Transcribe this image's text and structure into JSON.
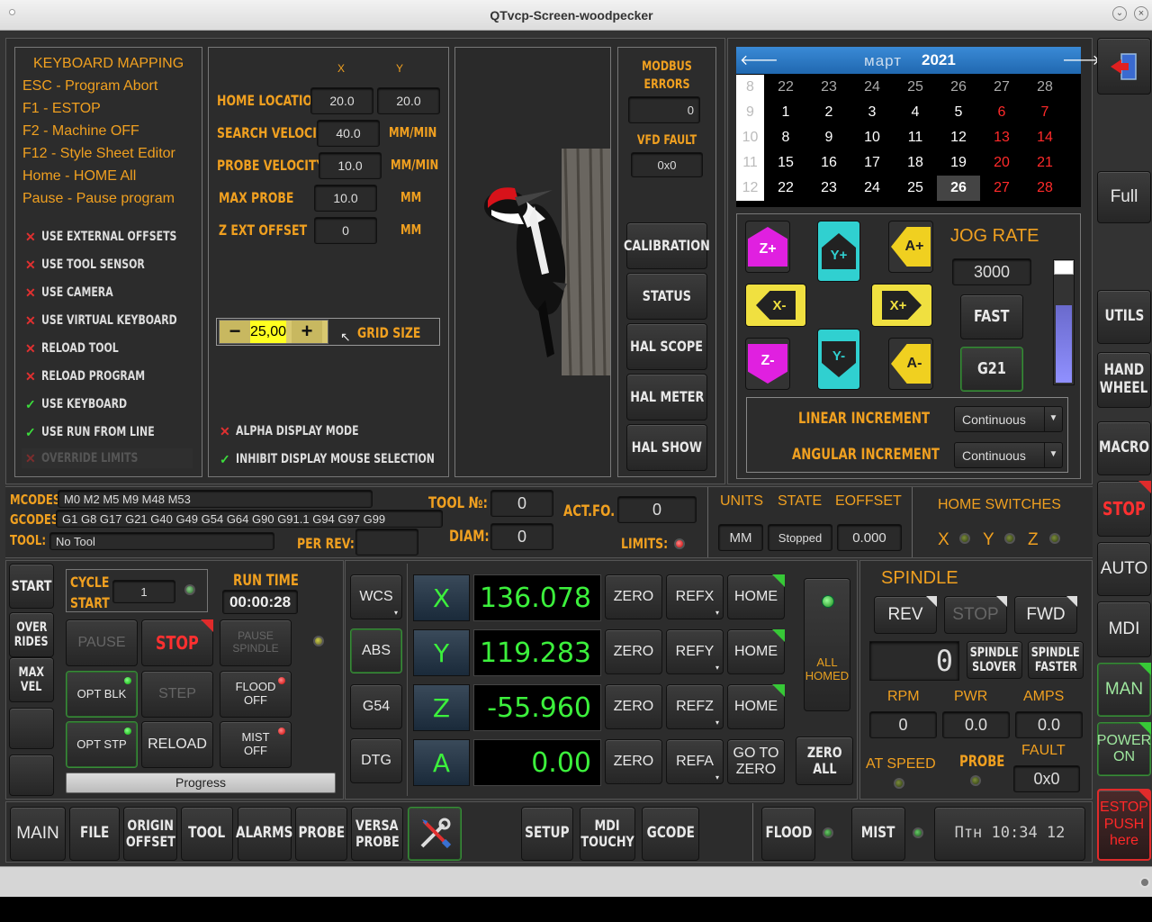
{
  "window": {
    "title": "QTvcp-Screen-woodpecker"
  },
  "keyboard": {
    "title": "KEYBOARD MAPPING",
    "lines": [
      "ESC - Program Abort",
      "F1 - ESTOP",
      "F2 - Machine OFF",
      "F12 - Style Sheet Editor",
      "Home - HOME All",
      "Pause - Pause program"
    ]
  },
  "options": [
    {
      "label": "USE EXTERNAL OFFSETS",
      "checked": false
    },
    {
      "label": "USE TOOL SENSOR",
      "checked": false
    },
    {
      "label": "USE CAMERA",
      "checked": false
    },
    {
      "label": "USE VIRTUAL KEYBOARD",
      "checked": false
    },
    {
      "label": "RELOAD TOOL",
      "checked": false
    },
    {
      "label": "RELOAD PROGRAM",
      "checked": false
    },
    {
      "label": "USE KEYBOARD",
      "checked": true
    },
    {
      "label": "USE RUN FROM LINE",
      "checked": true
    },
    {
      "label": "OVERRIDE LIMITS",
      "checked": false
    }
  ],
  "probe_settings": {
    "col_x": "X",
    "col_y": "Y",
    "home_location": "HOME LOCATION",
    "home_x": "20.0",
    "home_y": "20.0",
    "search_velocity": "SEARCH VELOCITY",
    "search_val": "40.0",
    "search_unit": "MM/MIN",
    "probe_velocity": "PROBE VELOCITY",
    "probe_val": "10.0",
    "probe_unit": "MM/MIN",
    "max_probe": "MAX PROBE",
    "max_val": "10.0",
    "max_unit": "MM",
    "z_ext": "Z EXT OFFSET",
    "z_val": "0",
    "z_unit": "MM",
    "grid_value": "25,00",
    "grid_label": "GRID SIZE",
    "alpha": "ALPHA DISPLAY MODE",
    "inhibit": "INHIBIT DISPLAY MOUSE SELECTION"
  },
  "modbus": {
    "title1": "MODBUS",
    "title2": "ERRORS",
    "errors": "0",
    "vfd_label": "VFD FAULT",
    "vfd": "0x0",
    "calibration": "CALIBRATION",
    "status": "STATUS",
    "hal_scope": "HAL SCOPE",
    "hal_meter": "HAL METER",
    "hal_show": "HAL SHOW"
  },
  "calendar": {
    "month": "март",
    "year": "2021",
    "weeks": [
      [
        "8",
        "22",
        "23",
        "24",
        "25",
        "26",
        "27",
        "28"
      ],
      [
        "9",
        "1",
        "2",
        "3",
        "4",
        "5",
        "6",
        "7"
      ],
      [
        "10",
        "8",
        "9",
        "10",
        "11",
        "12",
        "13",
        "14"
      ],
      [
        "11",
        "15",
        "16",
        "17",
        "18",
        "19",
        "20",
        "21"
      ],
      [
        "12",
        "22",
        "23",
        "24",
        "25",
        "26",
        "27",
        "28"
      ]
    ],
    "selected": "26"
  },
  "jog": {
    "zp": "Z+",
    "yp": "Y+",
    "ap": "A+",
    "xm": "X-",
    "xp": "X+",
    "zm": "Z-",
    "ym": "Y-",
    "am": "A-",
    "rate_label": "JOG RATE",
    "rate": "3000",
    "fast": "FAST",
    "g21": "G21",
    "linear_label": "LINEAR INCREMENT",
    "linear": "Continuous",
    "angular_label": "ANGULAR INCREMENT",
    "angular": "Continuous"
  },
  "right_bar": {
    "full": "Full",
    "utils": "UTILS",
    "hand1": "HAND",
    "hand2": "WHEEL",
    "macro": "MACRO",
    "stop": "STOP",
    "auto": "AUTO",
    "mdi": "MDI",
    "man": "MAN",
    "power1": "POWER",
    "power2": "ON",
    "estop1": "ESTOP",
    "estop2": "PUSH",
    "estop3": "here"
  },
  "status": {
    "mcodes_label": "MCODES:",
    "mcodes": "M0 M2 M5 M9 M48 M53",
    "gcodes_label": "GCODES:",
    "gcodes": "G1 G8 G17 G21 G40 G49 G54 G64 G90 G91.1 G94 G97 G99",
    "tool_label": "TOOL:",
    "tool": "No Tool",
    "perrev_label": "PER REV:",
    "toolno_label": "TOOL №:",
    "toolno": "0",
    "diam_label": "DIAM:",
    "diam": "0",
    "actfo_label": "ACT.FO.",
    "actfo": "0",
    "limits_label": "LIMITS:",
    "units_h": "UNITS",
    "state_h": "STATE",
    "eoffset_h": "EOFFSET",
    "units": "MM",
    "state": "Stopped",
    "eoffset": "0.000",
    "home_sw": "HOME SWITCHES",
    "sw_x": "X",
    "sw_y": "Y",
    "sw_z": "Z"
  },
  "run": {
    "start": "START",
    "over1": "OVER",
    "over2": "RIDES",
    "max1": "MAX",
    "max2": "VEL",
    "cycle1": "CYCLE",
    "cycle2": "START",
    "cycle_val": "1",
    "runtime_label": "RUN TIME",
    "runtime": "00:00:28",
    "pause": "PAUSE",
    "stop": "STOP",
    "pause_sp1": "PAUSE",
    "pause_sp2": "SPINDLE",
    "opt_blk": "OPT BLK",
    "step": "STEP",
    "flood1": "FLOOD",
    "flood2": "OFF",
    "opt_stp": "OPT STP",
    "reload": "RELOAD",
    "mist1": "MIST",
    "mist2": "OFF",
    "progress": "Progress"
  },
  "dro": {
    "wcs": "WCS",
    "abs": "ABS",
    "g54": "G54",
    "dtg": "DTG",
    "zero": "ZERO",
    "home": "HOME",
    "goto1": "GO TO",
    "goto2": "ZERO",
    "allhomed1": "ALL",
    "allhomed2": "HOMED",
    "zeroall1": "ZERO",
    "zeroall2": "ALL",
    "axes": [
      {
        "name": "X",
        "value": "136.078",
        "ref": "REFX"
      },
      {
        "name": "Y",
        "value": "119.283",
        "ref": "REFY"
      },
      {
        "name": "Z",
        "value": "-55.960",
        "ref": "REFZ"
      },
      {
        "name": "A",
        "value": "0.00",
        "ref": "REFA"
      }
    ]
  },
  "spindle": {
    "title": "SPINDLE",
    "rev": "REV",
    "stop": "STOP",
    "fwd": "FWD",
    "speed": "0",
    "slower1": "SPINDLE",
    "slower2": "SLOVER",
    "faster1": "SPINDLE",
    "faster2": "FASTER",
    "rpm_l": "RPM",
    "pwr_l": "PWR",
    "amps_l": "AMPS",
    "rpm": "0",
    "pwr": "0.0",
    "amps": "0.0",
    "atspeed": "AT SPEED",
    "probe": "PROBE",
    "fault_l": "FAULT",
    "fault": "0x0"
  },
  "tabs": {
    "main": "MAIN",
    "file": "FILE",
    "origin1": "ORIGIN",
    "origin2": "OFFSET",
    "tool": "TOOL",
    "alarms": "ALARMS",
    "probe": "PROBE",
    "versa1": "VERSA",
    "versa2": "PROBE",
    "setup": "SETUP",
    "mdi1": "MDI",
    "mdi2": "TOUCHY",
    "gcode": "GCODE",
    "flood": "FLOOD",
    "mist": "MIST",
    "clock": "Птн 10:34 12"
  }
}
